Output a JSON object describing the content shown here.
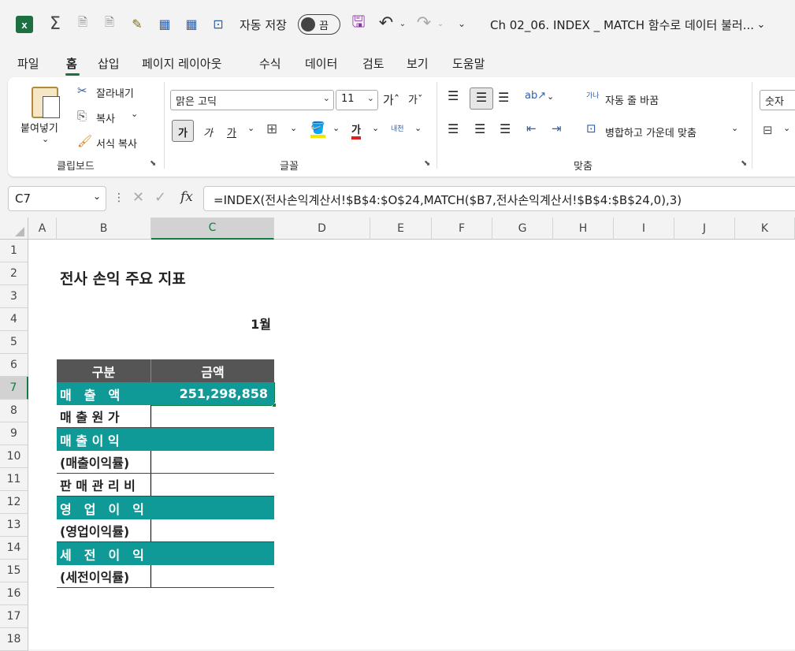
{
  "titlebar": {
    "autosave_label": "자동 저장",
    "autosave_state": "끔",
    "document_title": "Ch 02_06. INDEX _ MATCH 함수로 데이터 불러..."
  },
  "tabs": [
    "파일",
    "홈",
    "삽입",
    "페이지 레이아웃",
    "수식",
    "데이터",
    "검토",
    "보기",
    "도움말"
  ],
  "active_tab": "홈",
  "ribbon": {
    "clipboard": {
      "paste": "붙여넣기",
      "cut": "잘라내기",
      "copy": "복사",
      "format_painter": "서식 복사",
      "group": "클립보드"
    },
    "font": {
      "name": "맑은 고딕",
      "size": "11",
      "bold": "가",
      "italic": "가",
      "underline": "가",
      "group": "글꼴",
      "phonetic": "내천"
    },
    "alignment": {
      "wrap_text": "자동 줄 바꿈",
      "merge_center": "병합하고 가운데 맞춤",
      "group": "맞춤",
      "orientation": "가나"
    },
    "number": {
      "format": "숫자"
    }
  },
  "formula_bar": {
    "name_box": "C7",
    "fx": "fx",
    "formula": "=INDEX(전사손익계산서!$B$4:$O$24,MATCH($B7,전사손익계산서!$B$4:$B$24,0),3)"
  },
  "columns": [
    "A",
    "B",
    "C",
    "D",
    "E",
    "F",
    "G",
    "H",
    "I",
    "J",
    "K"
  ],
  "rows": [
    "1",
    "2",
    "3",
    "4",
    "5",
    "6",
    "7",
    "8",
    "9",
    "10",
    "11",
    "12",
    "13",
    "14",
    "15",
    "16",
    "17",
    "18"
  ],
  "sheet": {
    "title": "전사 손익 주요 지표",
    "month": "1월",
    "header_category": "구분",
    "header_amount": "금액",
    "items": [
      {
        "label": "매　출　액",
        "amount": "251,298,858"
      },
      {
        "label": "매 출 원 가",
        "amount": ""
      },
      {
        "label": "매 출 이 익",
        "amount": ""
      },
      {
        "label": "(매출이익률)",
        "amount": ""
      },
      {
        "label": "판 매 관 리 비",
        "amount": ""
      },
      {
        "label": "영　업　이　익",
        "amount": ""
      },
      {
        "label": "(영업이익률)",
        "amount": ""
      },
      {
        "label": "세　전　이　익",
        "amount": ""
      },
      {
        "label": "(세전이익률)",
        "amount": ""
      }
    ]
  },
  "colors": {
    "teal": "#0f9a98",
    "header_dark": "#555555",
    "excel_green": "#1d6f42",
    "selection": "#107c41"
  }
}
